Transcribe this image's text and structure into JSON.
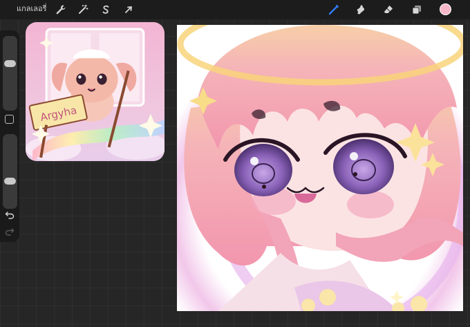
{
  "topbar": {
    "gallery_label": "แกลเลอรี่",
    "left_tools": [
      {
        "name": "actions",
        "icon": "wrench-icon"
      },
      {
        "name": "adjustments",
        "icon": "magic-wand-icon"
      },
      {
        "name": "selection",
        "icon": "selection-s-icon"
      },
      {
        "name": "transform",
        "icon": "arrow-cursor-icon"
      }
    ],
    "right_tools": [
      {
        "name": "brush",
        "icon": "brush-icon",
        "active": true
      },
      {
        "name": "smudge",
        "icon": "smudge-icon"
      },
      {
        "name": "eraser",
        "icon": "eraser-icon"
      },
      {
        "name": "layers",
        "icon": "layers-icon"
      }
    ],
    "current_color": "#f6b8c8"
  },
  "sidebar": {
    "brush_size_level": 0.35,
    "opacity_level": 0.65,
    "modify_icon": "square-icon",
    "undo_icon": "undo-icon",
    "redo_icon": "redo-icon"
  },
  "reference": {
    "sign_text": "Argyha"
  },
  "colors": {
    "active_tool": "#2f7cf6",
    "icon": "#d6d6d6",
    "topbar_bg": "#1c1c1c",
    "canvas_bg": "#262626",
    "hair_pink": "#f4a6b8",
    "eye_purple": "#8a62b8",
    "halo_yellow": "#f8d47a"
  }
}
